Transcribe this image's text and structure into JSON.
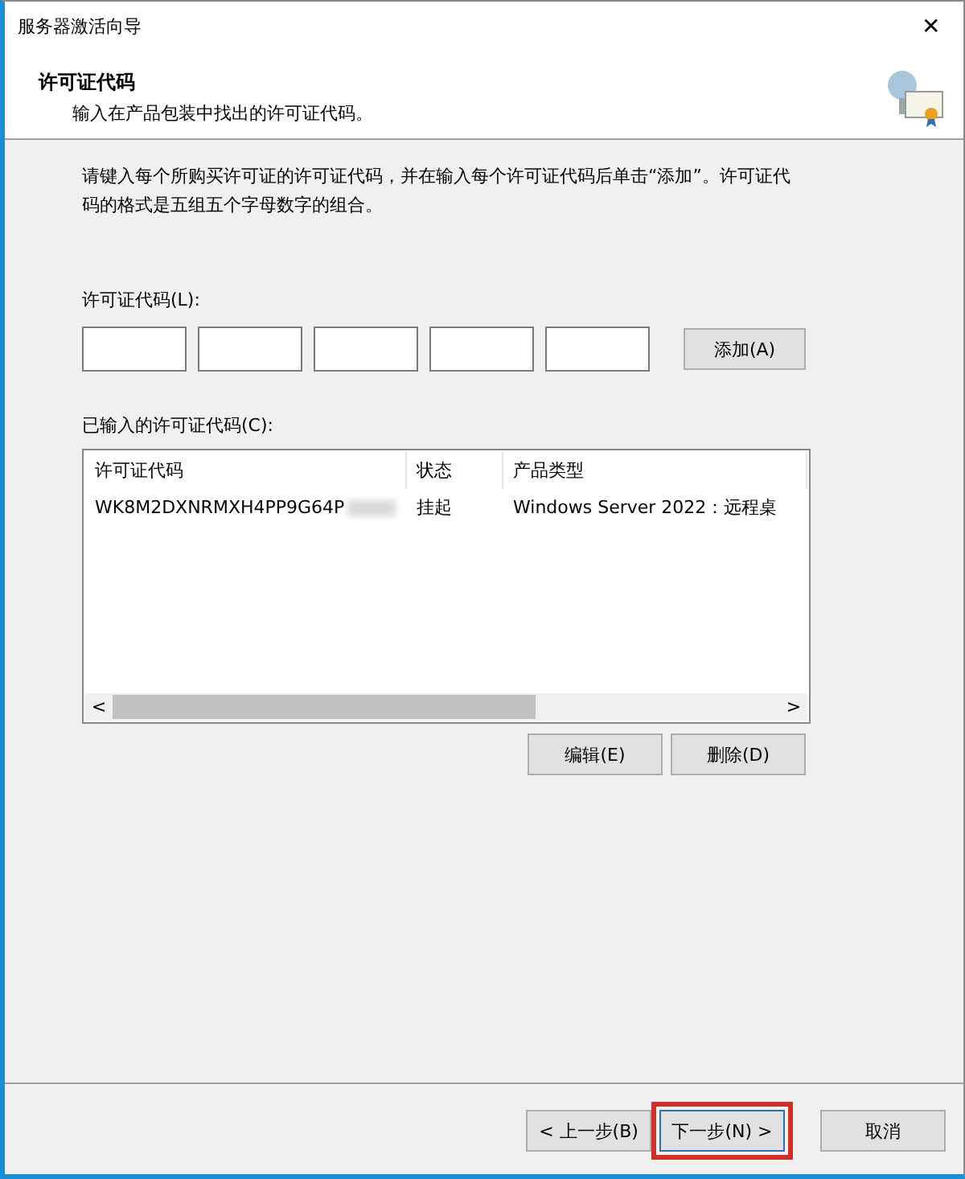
{
  "window": {
    "title": "服务器激活向导",
    "close": "✕"
  },
  "header": {
    "title": "许可证代码",
    "subtitle": "输入在产品包装中找出的许可证代码。"
  },
  "instructions": "请键入每个所购买许可证的许可证代码，并在输入每个许可证代码后单击“添加”。许可证代码的格式是五组五个字母数字的组合。",
  "code_label": "许可证代码(L):",
  "add_button": "添加(A)",
  "list_label": "已输入的许可证代码(C):",
  "table": {
    "columns": [
      "许可证代码",
      "状态",
      "产品类型"
    ],
    "rows": [
      {
        "cells": [
          "WK8M2DXNRMXH4PP9G64P",
          "挂起",
          "Windows Server 2022：远程桌"
        ],
        "redacted": true
      }
    ],
    "scroll_left": "<",
    "scroll_right": ">"
  },
  "list_buttons": [
    "编辑(E)",
    "删除(D)"
  ],
  "footer_buttons": [
    {
      "label": "< 上一步(B)",
      "highlighted": false
    },
    {
      "label": "下一步(N) >",
      "highlighted": true
    },
    {
      "label": "取消",
      "highlighted": false
    }
  ]
}
